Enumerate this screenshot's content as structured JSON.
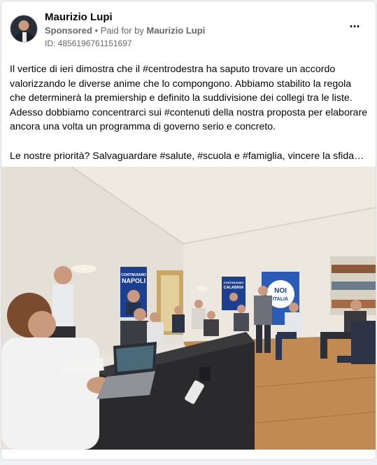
{
  "post": {
    "author": "Maurizio Lupi",
    "sponsored_label": "Sponsored",
    "separator": "•",
    "paid_prefix": "Paid for by",
    "paid_by": "Maurizio Lupi",
    "id_line": "ID: 4856196761151697",
    "more_icon": "more-options-icon",
    "paragraph_1": "Il vertice di ieri dimostra che il #centrodestra ha saputo trovare un accordo valorizzando le diverse anime che lo compongono. Abbiamo stabilito la regola che determinerà la premiership e definito la suddivisione dei collegi tra le liste. Adesso dobbiamo concentrarci sui #contenuti della nostra proposta per elaborare ancora una volta un programma di governo serio e concreto.",
    "paragraph_2": "Le nostre priorità? Salvaguardare #salute, #scuola e #famiglia, vincere la sfida…"
  },
  "photo": {
    "poster_left": {
      "line1": "CONTINUIAMO",
      "line2": "NAPOLI"
    },
    "poster_mid": {
      "line1": "CONTINUIAMO",
      "line2": "CALABRIA"
    },
    "poster_right": {
      "line1": "NOI",
      "line2": "ITALIA"
    }
  },
  "colors": {
    "card_bg": "#ffffff",
    "page_bg": "#f0f2f5",
    "secondary_text": "#65676b",
    "poster_blue": "#1d3f8f"
  }
}
